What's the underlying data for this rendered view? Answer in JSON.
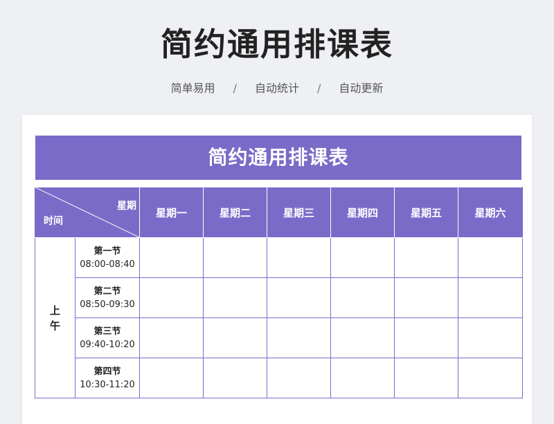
{
  "page": {
    "title": "简约通用排课表",
    "tags": [
      "简单易用",
      "自动统计",
      "自动更新"
    ],
    "separator": "/"
  },
  "sheet": {
    "banner": "简约通用排课表",
    "corner": {
      "top": "星期",
      "bottom": "时间"
    },
    "days": [
      "星期一",
      "星期二",
      "星期三",
      "星期四",
      "星期五",
      "星期六"
    ],
    "session": {
      "line1": "上",
      "line2": "午"
    },
    "periods": [
      {
        "name": "第一节",
        "time": "08:00-08:40"
      },
      {
        "name": "第二节",
        "time": "08:50-09:30"
      },
      {
        "name": "第三节",
        "time": "09:40-10:20"
      },
      {
        "name": "第四节",
        "time": "10:30-11:20"
      }
    ]
  },
  "colors": {
    "accent": "#7b6bc8",
    "background": "#eef0f4",
    "title_text": "#222222"
  }
}
